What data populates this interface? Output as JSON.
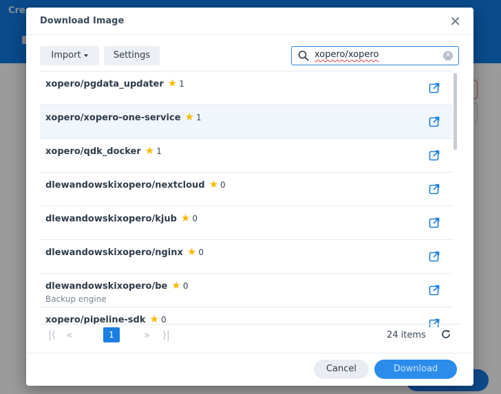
{
  "background": {
    "title_fragment": "Cre"
  },
  "dialog": {
    "title": "Download Image",
    "close_glyph": "✕",
    "toolbar": {
      "import_label": "Import",
      "settings_label": "Settings"
    },
    "search": {
      "value": "xopero/xopero",
      "icon": "search-icon",
      "clear_icon": "clear-icon"
    },
    "results": [
      {
        "name": "xopero/pgdata_updater",
        "stars": "1",
        "description": ""
      },
      {
        "name": "xopero/xopero-one-service",
        "stars": "1",
        "description": "",
        "selected": true
      },
      {
        "name": "xopero/qdk_docker",
        "stars": "1",
        "description": ""
      },
      {
        "name": "dlewandowskixopero/nextcloud",
        "stars": "0",
        "description": ""
      },
      {
        "name": "dlewandowskixopero/kjub",
        "stars": "0",
        "description": ""
      },
      {
        "name": "dlewandowskixopero/nginx",
        "stars": "0",
        "description": ""
      },
      {
        "name": "dlewandowskixopero/be",
        "stars": "0",
        "description": "Backup engine"
      },
      {
        "name": "xopero/pipeline-sdk",
        "stars": "0",
        "description": ""
      }
    ],
    "pagination": {
      "current_page": "1",
      "items_label": "24 items"
    },
    "footer": {
      "cancel_label": "Cancel",
      "download_label": "Download"
    }
  },
  "colors": {
    "accent": "#1b7ee0",
    "star": "#f5b800",
    "header": "#0f79e3"
  }
}
